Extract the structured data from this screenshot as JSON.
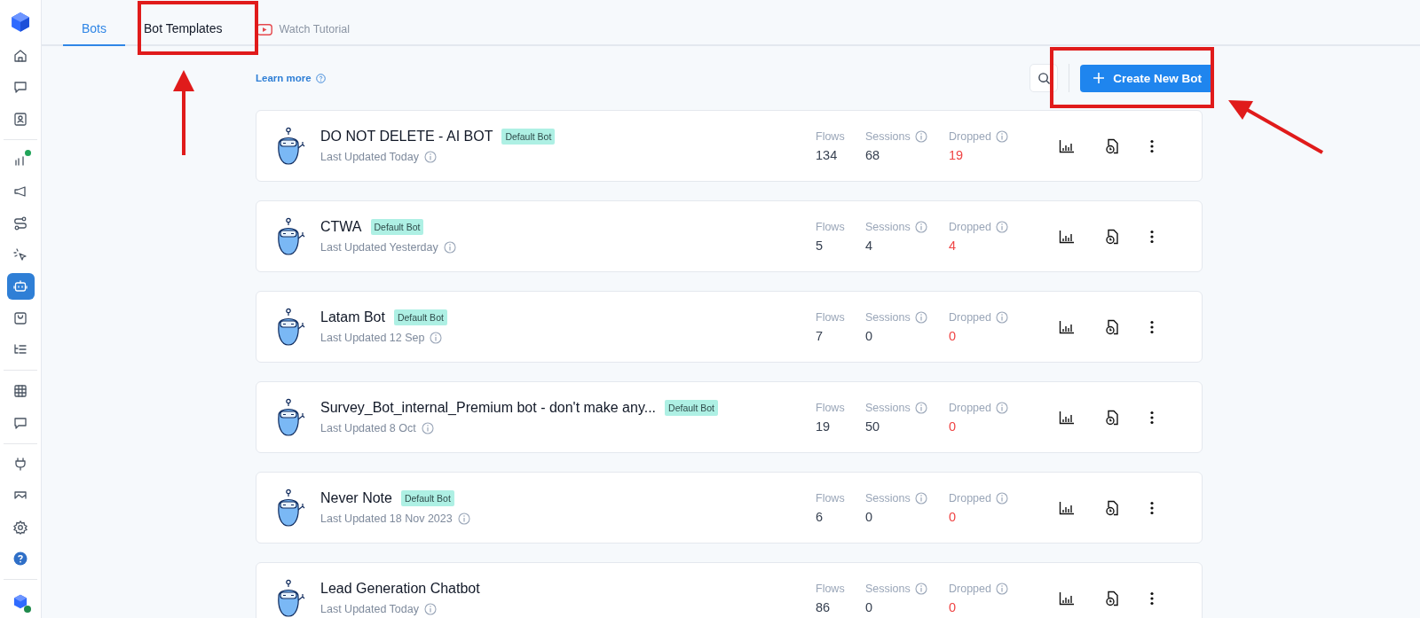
{
  "sidebar": {
    "groups": [
      [
        {
          "selected": false,
          "badge": false
        },
        {
          "selected": false,
          "badge": false
        },
        {
          "selected": false,
          "badge": false
        }
      ],
      [
        {
          "selected": false,
          "badge": true
        },
        {
          "selected": false,
          "badge": false
        },
        {
          "selected": false,
          "badge": false
        },
        {
          "selected": false,
          "badge": false
        },
        {
          "selected": true,
          "badge": false
        },
        {
          "selected": false,
          "badge": false
        },
        {
          "selected": false,
          "badge": false
        }
      ],
      [
        {
          "selected": false,
          "badge": false
        },
        {
          "selected": false,
          "badge": false
        }
      ],
      [
        {
          "selected": false,
          "badge": false
        },
        {
          "selected": false,
          "badge": false
        }
      ]
    ]
  },
  "tabs": [
    {
      "label": "Bots",
      "selected": true,
      "kind": "tab"
    },
    {
      "label": "Bot Templates",
      "selected": false,
      "kind": "tab"
    },
    {
      "label": "Watch Tutorial",
      "selected": false,
      "kind": "video"
    }
  ],
  "learn_more": "Learn more",
  "create_button": "Create New Bot",
  "bots": [
    {
      "name": "DO NOT DELETE - AI BOT",
      "badge": "Default Bot",
      "updated": "Last Updated Today",
      "stats": [
        {
          "kind": "flows",
          "label": "Flows",
          "value": "134"
        },
        {
          "kind": "sessions",
          "label": "Sessions",
          "value": "68"
        },
        {
          "kind": "dropped",
          "label": "Dropped",
          "value": "19"
        }
      ]
    },
    {
      "name": "CTWA",
      "badge": "Default Bot",
      "updated": "Last Updated Yesterday",
      "stats": [
        {
          "kind": "flows",
          "label": "Flows",
          "value": "5"
        },
        {
          "kind": "sessions",
          "label": "Sessions",
          "value": "4"
        },
        {
          "kind": "dropped",
          "label": "Dropped",
          "value": "4"
        }
      ]
    },
    {
      "name": "Latam Bot",
      "badge": "Default Bot",
      "updated": "Last Updated 12 Sep",
      "stats": [
        {
          "kind": "flows",
          "label": "Flows",
          "value": "7"
        },
        {
          "kind": "sessions",
          "label": "Sessions",
          "value": "0"
        },
        {
          "kind": "dropped",
          "label": "Dropped",
          "value": "0"
        }
      ]
    },
    {
      "name": "Survey_Bot_internal_Premium bot - don't make any...",
      "badge": "Default Bot",
      "updated": "Last Updated 8 Oct",
      "stats": [
        {
          "kind": "flows",
          "label": "Flows",
          "value": "19"
        },
        {
          "kind": "sessions",
          "label": "Sessions",
          "value": "50"
        },
        {
          "kind": "dropped",
          "label": "Dropped",
          "value": "0"
        }
      ]
    },
    {
      "name": "Never Note",
      "badge": "Default Bot",
      "updated": "Last Updated 18 Nov 2023",
      "stats": [
        {
          "kind": "flows",
          "label": "Flows",
          "value": "6"
        },
        {
          "kind": "sessions",
          "label": "Sessions",
          "value": "0"
        },
        {
          "kind": "dropped",
          "label": "Dropped",
          "value": "0"
        }
      ]
    },
    {
      "name": "Lead Generation Chatbot",
      "updated": "Last Updated Today",
      "stats": [
        {
          "kind": "flows",
          "label": "Flows",
          "value": "86"
        },
        {
          "kind": "sessions",
          "label": "Sessions",
          "value": "0"
        },
        {
          "kind": "dropped",
          "label": "Dropped",
          "value": "0"
        }
      ]
    }
  ]
}
